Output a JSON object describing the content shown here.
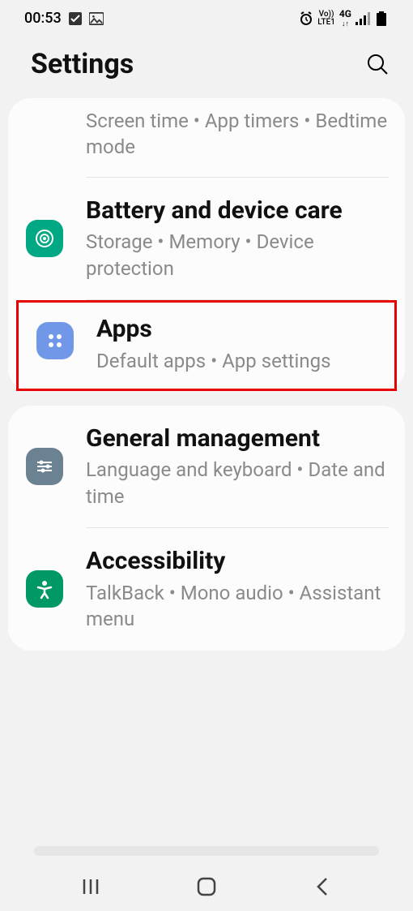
{
  "status": {
    "time": "00:53",
    "net_label_top": "Vo))",
    "net_label_bot": "LTE1",
    "net_type": "4G"
  },
  "header": {
    "title": "Settings"
  },
  "card1": {
    "digital_sub": "Screen time  •  App timers  •  Bedtime mode",
    "battery_title": "Battery and device care",
    "battery_sub": "Storage  •  Memory  •  Device protection",
    "apps_title": "Apps",
    "apps_sub": "Default apps  •  App settings"
  },
  "card2": {
    "general_title": "General management",
    "general_sub": "Language and keyboard  •  Date and time",
    "accessibility_title": "Accessibility",
    "accessibility_sub": "TalkBack  •  Mono audio  •  Assistant menu"
  }
}
